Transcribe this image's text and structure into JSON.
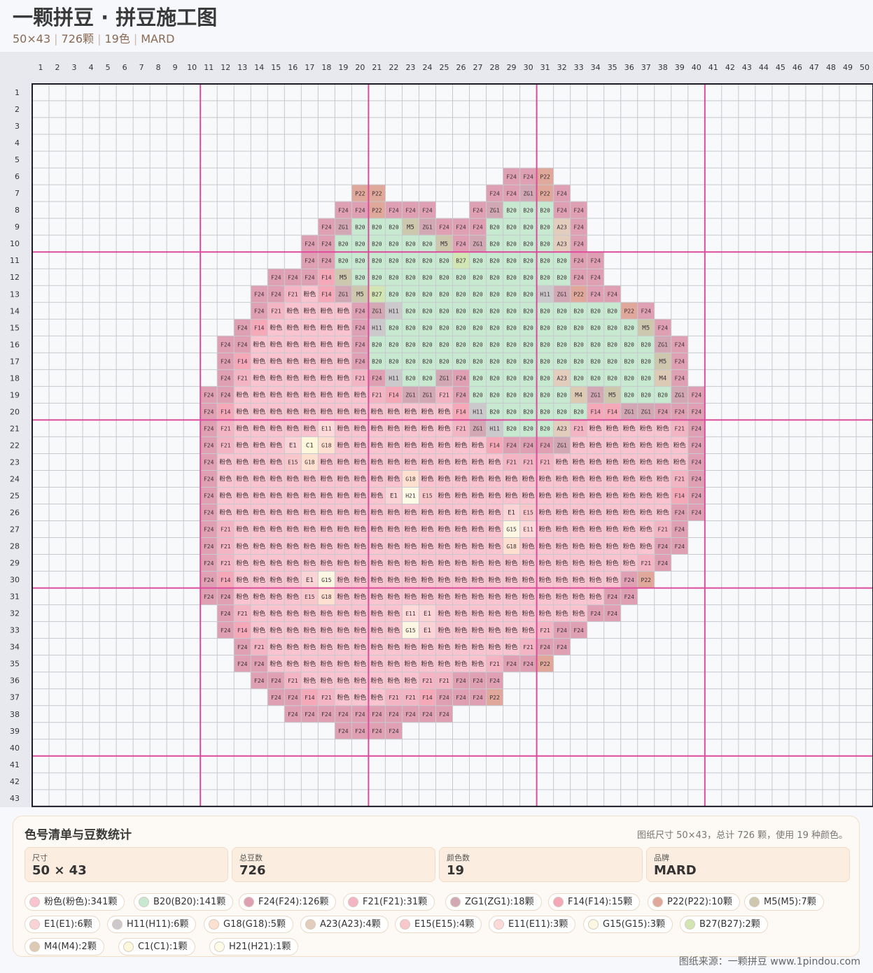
{
  "header": {
    "title": "一颗拼豆 · 拼豆施工图",
    "subtitle_parts": [
      "50×43",
      "726颗",
      "19色",
      "MARD"
    ]
  },
  "pattern": {
    "cols": 50,
    "rows": 43,
    "col_numbers": [
      "1",
      "2",
      "3",
      "4",
      "5",
      "6",
      "7",
      "8",
      "9",
      "10",
      "11",
      "12",
      "13",
      "14",
      "15",
      "16",
      "17",
      "18",
      "19",
      "20",
      "21",
      "22",
      "23",
      "24",
      "25",
      "26",
      "27",
      "28",
      "29",
      "30",
      "31",
      "32",
      "33",
      "34",
      "35",
      "36",
      "37",
      "38",
      "39",
      "40",
      "41",
      "42",
      "43",
      "44",
      "45",
      "46",
      "47",
      "48",
      "49",
      "50"
    ],
    "row_numbers": [
      "1",
      "2",
      "3",
      "4",
      "5",
      "6",
      "7",
      "8",
      "9",
      "10",
      "11",
      "12",
      "13",
      "14",
      "15",
      "16",
      "17",
      "18",
      "19",
      "20",
      "21",
      "22",
      "23",
      "24",
      "25",
      "26",
      "27",
      "28",
      "29",
      "30",
      "31",
      "32",
      "33",
      "34",
      "35",
      "36",
      "37",
      "38",
      "39",
      "40",
      "41",
      "42",
      "43"
    ],
    "rows_data": [
      {
        "row": 6,
        "start": 29,
        "cells": [
          "F24",
          "F24",
          "P22"
        ]
      },
      {
        "row": 7,
        "start": 20,
        "cells": [
          "P22",
          "P22"
        ]
      },
      {
        "row": 7,
        "start": 28,
        "cells": [
          "F24",
          "F24",
          "ZG1",
          "P22",
          "F24"
        ]
      },
      {
        "row": 8,
        "start": 19,
        "cells": [
          "F24",
          "F24",
          "P22",
          "F24",
          "F24",
          "F24"
        ]
      },
      {
        "row": 8,
        "start": 27,
        "cells": [
          "F24",
          "ZG1",
          "B20",
          "B20",
          "B20",
          "F24",
          "F24"
        ]
      },
      {
        "row": 9,
        "start": 18,
        "cells": [
          "F24",
          "ZG1",
          "B20",
          "B20",
          "B20",
          "M5",
          "ZG1",
          "F24",
          "F24",
          "F24",
          "B20",
          "B20",
          "B20",
          "B20",
          "A23",
          "F24"
        ]
      },
      {
        "row": 10,
        "start": 17,
        "cells": [
          "F24",
          "F24",
          "B20",
          "B20",
          "B20",
          "B20",
          "B20",
          "B20",
          "M5",
          "F24",
          "ZG1",
          "B20",
          "B20",
          "B20",
          "B20",
          "A23",
          "F24"
        ]
      },
      {
        "row": 11,
        "start": 17,
        "cells": [
          "F24",
          "F24",
          "B20",
          "B20",
          "B20",
          "B20",
          "B20",
          "B20",
          "B20",
          "B27",
          "B20",
          "B20",
          "B20",
          "B20",
          "B20",
          "B20",
          "F24",
          "F24"
        ]
      },
      {
        "row": 12,
        "start": 15,
        "cells": [
          "F24",
          "F24",
          "F24",
          "F14",
          "M5",
          "B20",
          "B20",
          "B20",
          "B20",
          "B20",
          "B20",
          "B20",
          "B20",
          "B20",
          "B20",
          "B20",
          "B20",
          "B20",
          "F24",
          "F24"
        ]
      },
      {
        "row": 13,
        "start": 14,
        "cells": [
          "F24",
          "F24",
          "F21",
          "粉色",
          "F14",
          "ZG1",
          "M5",
          "B27",
          "B20",
          "B20",
          "B20",
          "B20",
          "B20",
          "B20",
          "B20",
          "B20",
          "B20",
          "H11",
          "ZG1",
          "P22",
          "F24",
          "F24"
        ]
      },
      {
        "row": 14,
        "start": 14,
        "cells": [
          "F24",
          "F21",
          "粉色",
          "粉色",
          "粉色",
          "粉色",
          "F24",
          "ZG1",
          "H11",
          "B20",
          "B20",
          "B20",
          "B20",
          "B20",
          "B20",
          "B20",
          "B20",
          "B20",
          "B20",
          "B20",
          "B20",
          "B20",
          "P22",
          "F24"
        ]
      },
      {
        "row": 15,
        "start": 13,
        "cells": [
          "F24",
          "F14",
          "粉色",
          "粉色",
          "粉色",
          "粉色",
          "粉色",
          "F24",
          "H11",
          "B20",
          "B20",
          "B20",
          "B20",
          "B20",
          "B20",
          "B20",
          "B20",
          "B20",
          "B20",
          "B20",
          "B20",
          "B20",
          "B20",
          "B20",
          "M5",
          "F24"
        ]
      },
      {
        "row": 16,
        "start": 12,
        "cells": [
          "F24",
          "F24",
          "粉色",
          "粉色",
          "粉色",
          "粉色",
          "粉色",
          "粉色",
          "F24",
          "B20",
          "B20",
          "B20",
          "B20",
          "B20",
          "B20",
          "B20",
          "B20",
          "B20",
          "B20",
          "B20",
          "B20",
          "B20",
          "B20",
          "B20",
          "B20",
          "B20",
          "ZG1",
          "F24"
        ]
      },
      {
        "row": 17,
        "start": 12,
        "cells": [
          "F24",
          "F14",
          "粉色",
          "粉色",
          "粉色",
          "粉色",
          "粉色",
          "粉色",
          "F24",
          "B20",
          "B20",
          "B20",
          "B20",
          "B20",
          "B20",
          "B20",
          "B20",
          "B20",
          "B20",
          "B20",
          "B20",
          "B20",
          "B20",
          "B20",
          "B20",
          "B20",
          "M5",
          "F24"
        ]
      },
      {
        "row": 18,
        "start": 12,
        "cells": [
          "F24",
          "F21",
          "粉色",
          "粉色",
          "粉色",
          "粉色",
          "粉色",
          "粉色",
          "F21",
          "F24",
          "H11",
          "B20",
          "B20",
          "ZG1",
          "F24",
          "B20",
          "B20",
          "B20",
          "B20",
          "B20",
          "A23",
          "B20",
          "B20",
          "B20",
          "B20",
          "B20",
          "M4",
          "F24"
        ]
      },
      {
        "row": 19,
        "start": 11,
        "cells": [
          "F24",
          "F24",
          "粉色",
          "粉色",
          "粉色",
          "粉色",
          "粉色",
          "粉色",
          "粉色",
          "粉色",
          "F21",
          "F14",
          "ZG1",
          "ZG1",
          "F21",
          "F24",
          "B20",
          "B20",
          "B20",
          "B20",
          "B20",
          "B20",
          "M4",
          "ZG1",
          "M5",
          "B20",
          "B20",
          "B20",
          "ZG1",
          "F24"
        ]
      },
      {
        "row": 20,
        "start": 11,
        "cells": [
          "F24",
          "F14",
          "粉色",
          "粉色",
          "粉色",
          "粉色",
          "粉色",
          "粉色",
          "粉色",
          "粉色",
          "粉色",
          "粉色",
          "粉色",
          "粉色",
          "粉色",
          "F14",
          "H11",
          "B20",
          "B20",
          "B20",
          "B20",
          "B20",
          "B20",
          "F14",
          "F14",
          "ZG1",
          "ZG1",
          "F24",
          "F24",
          "F24"
        ]
      },
      {
        "row": 21,
        "start": 11,
        "cells": [
          "F24",
          "F21",
          "粉色",
          "粉色",
          "粉色",
          "粉色",
          "粉色",
          "E11",
          "粉色",
          "粉色",
          "粉色",
          "粉色",
          "粉色",
          "粉色",
          "粉色",
          "F21",
          "ZG1",
          "H11",
          "B20",
          "B20",
          "B20",
          "A23",
          "F21",
          "粉色",
          "粉色",
          "粉色",
          "粉色",
          "粉色",
          "F21",
          "F24"
        ]
      },
      {
        "row": 22,
        "start": 11,
        "cells": [
          "F24",
          "F21",
          "粉色",
          "粉色",
          "粉色",
          "E1",
          "C1",
          "G18",
          "粉色",
          "粉色",
          "粉色",
          "粉色",
          "粉色",
          "粉色",
          "粉色",
          "粉色",
          "粉色",
          "F14",
          "F24",
          "F24",
          "F24",
          "ZG1",
          "粉色",
          "粉色",
          "粉色",
          "粉色",
          "粉色",
          "粉色",
          "粉色",
          "F24"
        ]
      },
      {
        "row": 23,
        "start": 11,
        "cells": [
          "F24",
          "粉色",
          "粉色",
          "粉色",
          "粉色",
          "E15",
          "G18",
          "粉色",
          "粉色",
          "粉色",
          "粉色",
          "粉色",
          "粉色",
          "粉色",
          "粉色",
          "粉色",
          "粉色",
          "粉色",
          "F21",
          "F21",
          "F21",
          "粉色",
          "粉色",
          "粉色",
          "粉色",
          "粉色",
          "粉色",
          "粉色",
          "粉色",
          "F24"
        ]
      },
      {
        "row": 24,
        "start": 11,
        "cells": [
          "F24",
          "粉色",
          "粉色",
          "粉色",
          "粉色",
          "粉色",
          "粉色",
          "粉色",
          "粉色",
          "粉色",
          "粉色",
          "粉色",
          "G18",
          "粉色",
          "粉色",
          "粉色",
          "粉色",
          "粉色",
          "粉色",
          "粉色",
          "粉色",
          "粉色",
          "粉色",
          "粉色",
          "粉色",
          "粉色",
          "粉色",
          "粉色",
          "F21",
          "F24"
        ]
      },
      {
        "row": 25,
        "start": 11,
        "cells": [
          "F24",
          "粉色",
          "粉色",
          "粉色",
          "粉色",
          "粉色",
          "粉色",
          "粉色",
          "粉色",
          "粉色",
          "粉色",
          "E1",
          "H21",
          "E15",
          "粉色",
          "粉色",
          "粉色",
          "粉色",
          "粉色",
          "粉色",
          "粉色",
          "粉色",
          "粉色",
          "粉色",
          "粉色",
          "粉色",
          "粉色",
          "粉色",
          "F14",
          "F24"
        ]
      },
      {
        "row": 26,
        "start": 11,
        "cells": [
          "F24",
          "粉色",
          "粉色",
          "粉色",
          "粉色",
          "粉色",
          "粉色",
          "粉色",
          "粉色",
          "粉色",
          "粉色",
          "粉色",
          "粉色",
          "粉色",
          "粉色",
          "粉色",
          "粉色",
          "粉色",
          "E1",
          "E15",
          "粉色",
          "粉色",
          "粉色",
          "粉色",
          "粉色",
          "粉色",
          "粉色",
          "粉色",
          "F24",
          "F24"
        ]
      },
      {
        "row": 27,
        "start": 11,
        "cells": [
          "F24",
          "F21",
          "粉色",
          "粉色",
          "粉色",
          "粉色",
          "粉色",
          "粉色",
          "粉色",
          "粉色",
          "粉色",
          "粉色",
          "粉色",
          "粉色",
          "粉色",
          "粉色",
          "粉色",
          "粉色",
          "G15",
          "E11",
          "粉色",
          "粉色",
          "粉色",
          "粉色",
          "粉色",
          "粉色",
          "粉色",
          "F21",
          "F24"
        ]
      },
      {
        "row": 28,
        "start": 11,
        "cells": [
          "F24",
          "F21",
          "粉色",
          "粉色",
          "粉色",
          "粉色",
          "粉色",
          "粉色",
          "粉色",
          "粉色",
          "粉色",
          "粉色",
          "粉色",
          "粉色",
          "粉色",
          "粉色",
          "粉色",
          "粉色",
          "G18",
          "粉色",
          "粉色",
          "粉色",
          "粉色",
          "粉色",
          "粉色",
          "粉色",
          "粉色",
          "F24",
          "F24"
        ]
      },
      {
        "row": 29,
        "start": 11,
        "cells": [
          "F24",
          "F21",
          "粉色",
          "粉色",
          "粉色",
          "粉色",
          "粉色",
          "粉色",
          "粉色",
          "粉色",
          "粉色",
          "粉色",
          "粉色",
          "粉色",
          "粉色",
          "粉色",
          "粉色",
          "粉色",
          "粉色",
          "粉色",
          "粉色",
          "粉色",
          "粉色",
          "粉色",
          "粉色",
          "粉色",
          "F21",
          "F24"
        ]
      },
      {
        "row": 30,
        "start": 11,
        "cells": [
          "F24",
          "F14",
          "粉色",
          "粉色",
          "粉色",
          "粉色",
          "E1",
          "G15",
          "粉色",
          "粉色",
          "粉色",
          "粉色",
          "粉色",
          "粉色",
          "粉色",
          "粉色",
          "粉色",
          "粉色",
          "粉色",
          "粉色",
          "粉色",
          "粉色",
          "粉色",
          "粉色",
          "粉色",
          "F24",
          "P22"
        ]
      },
      {
        "row": 31,
        "start": 11,
        "cells": [
          "F24",
          "F24",
          "粉色",
          "粉色",
          "粉色",
          "粉色",
          "E15",
          "G18",
          "粉色",
          "粉色",
          "粉色",
          "粉色",
          "粉色",
          "粉色",
          "粉色",
          "粉色",
          "粉色",
          "粉色",
          "粉色",
          "粉色",
          "粉色",
          "粉色",
          "粉色",
          "粉色",
          "F24",
          "F24"
        ]
      },
      {
        "row": 32,
        "start": 12,
        "cells": [
          "F24",
          "F21",
          "粉色",
          "粉色",
          "粉色",
          "粉色",
          "粉色",
          "粉色",
          "粉色",
          "粉色",
          "粉色",
          "E11",
          "E1",
          "粉色",
          "粉色",
          "粉色",
          "粉色",
          "粉色",
          "粉色",
          "粉色",
          "粉色",
          "粉色",
          "F24",
          "F24"
        ]
      },
      {
        "row": 33,
        "start": 12,
        "cells": [
          "F24",
          "F14",
          "粉色",
          "粉色",
          "粉色",
          "粉色",
          "粉色",
          "粉色",
          "粉色",
          "粉色",
          "粉色",
          "G15",
          "E1",
          "粉色",
          "粉色",
          "粉色",
          "粉色",
          "粉色",
          "粉色",
          "F21",
          "F24",
          "F24"
        ]
      },
      {
        "row": 34,
        "start": 13,
        "cells": [
          "F24",
          "F21",
          "粉色",
          "粉色",
          "粉色",
          "粉色",
          "粉色",
          "粉色",
          "粉色",
          "粉色",
          "粉色",
          "粉色",
          "粉色",
          "粉色",
          "粉色",
          "粉色",
          "粉色",
          "F21",
          "F24",
          "F24"
        ]
      },
      {
        "row": 35,
        "start": 13,
        "cells": [
          "F24",
          "F24",
          "粉色",
          "粉色",
          "粉色",
          "粉色",
          "粉色",
          "粉色",
          "粉色",
          "粉色",
          "粉色",
          "粉色",
          "粉色",
          "粉色",
          "粉色",
          "F21",
          "F24",
          "F24",
          "P22"
        ]
      },
      {
        "row": 36,
        "start": 14,
        "cells": [
          "F24",
          "F24",
          "F21",
          "粉色",
          "粉色",
          "粉色",
          "粉色",
          "粉色",
          "粉色",
          "粉色",
          "F21",
          "F21",
          "F24",
          "F24",
          "F24"
        ]
      },
      {
        "row": 37,
        "start": 15,
        "cells": [
          "F24",
          "F24",
          "F14",
          "F21",
          "粉色",
          "粉色",
          "粉色",
          "F21",
          "F21",
          "F14",
          "F24",
          "F24",
          "F24",
          "P22"
        ]
      },
      {
        "row": 38,
        "start": 16,
        "cells": [
          "F24",
          "F24",
          "F24",
          "F24",
          "F24",
          "F24",
          "F24",
          "F24",
          "F24",
          "F24"
        ]
      },
      {
        "row": 39,
        "start": 19,
        "cells": [
          "F24",
          "F24",
          "F24",
          "F24"
        ]
      }
    ]
  },
  "colors": {
    "粉色": "#f9c3d0",
    "B20": "#c6e9cf",
    "F24": "#e0a0b4",
    "F21": "#f3b4c4",
    "ZG1": "#d3a8b5",
    "F14": "#f4a8b8",
    "P22": "#e0a89a",
    "M5": "#cdc7ad",
    "E1": "#fad3d6",
    "H11": "#ccc9cc",
    "G18": "#fde0d0",
    "A23": "#e3cdbd",
    "E15": "#f8c7cc",
    "E11": "#fdd9da",
    "G15": "#fbf7e3",
    "B27": "#d2e6b4",
    "M4": "#dccab4",
    "C1": "#fdf7dc",
    "H21": "#fbfbe8",
    "grid_line": "#c7c9cf",
    "major_line": "#dd4b9c",
    "accent": "#dd4b9c"
  },
  "panel": {
    "title": "色号清单与豆数统计",
    "note": "图纸尺寸 50×43，总计 726 颗，使用 19 种颜色。",
    "stats": [
      {
        "label": "尺寸",
        "value": "50 × 43"
      },
      {
        "label": "总豆数",
        "value": "726"
      },
      {
        "label": "颜色数",
        "value": "19"
      },
      {
        "label": "品牌",
        "value": "MARD"
      }
    ],
    "chips": [
      {
        "text": "粉色(粉色):341颗",
        "color": "#f9c3d0"
      },
      {
        "text": "B20(B20):141颗",
        "color": "#c6e9cf"
      },
      {
        "text": "F24(F24):126颗",
        "color": "#e0a0b4"
      },
      {
        "text": "F21(F21):31颗",
        "color": "#f3b4c4"
      },
      {
        "text": "ZG1(ZG1):18颗",
        "color": "#d3a8b5"
      },
      {
        "text": "F14(F14):15颗",
        "color": "#f4a8b8"
      },
      {
        "text": "P22(P22):10颗",
        "color": "#e0a89a"
      },
      {
        "text": "M5(M5):7颗",
        "color": "#cdc7ad"
      },
      {
        "text": "E1(E1):6颗",
        "color": "#fad3d6"
      },
      {
        "text": "H11(H11):6颗",
        "color": "#ccc9cc"
      },
      {
        "text": "G18(G18):5颗",
        "color": "#fde0d0"
      },
      {
        "text": "A23(A23):4颗",
        "color": "#e3cdbd"
      },
      {
        "text": "E15(E15):4颗",
        "color": "#f8c7cc"
      },
      {
        "text": "E11(E11):3颗",
        "color": "#fdd9da"
      },
      {
        "text": "G15(G15):3颗",
        "color": "#fbf7e3"
      },
      {
        "text": "B27(B27):2颗",
        "color": "#d2e6b4"
      },
      {
        "text": "M4(M4):2颗",
        "color": "#dccab4"
      },
      {
        "text": "C1(C1):1颗",
        "color": "#fdf7dc"
      },
      {
        "text": "H21(H21):1颗",
        "color": "#fbfbe8"
      }
    ]
  },
  "footer": {
    "source": "图纸来源：一颗拼豆 www.1pindou.com"
  }
}
